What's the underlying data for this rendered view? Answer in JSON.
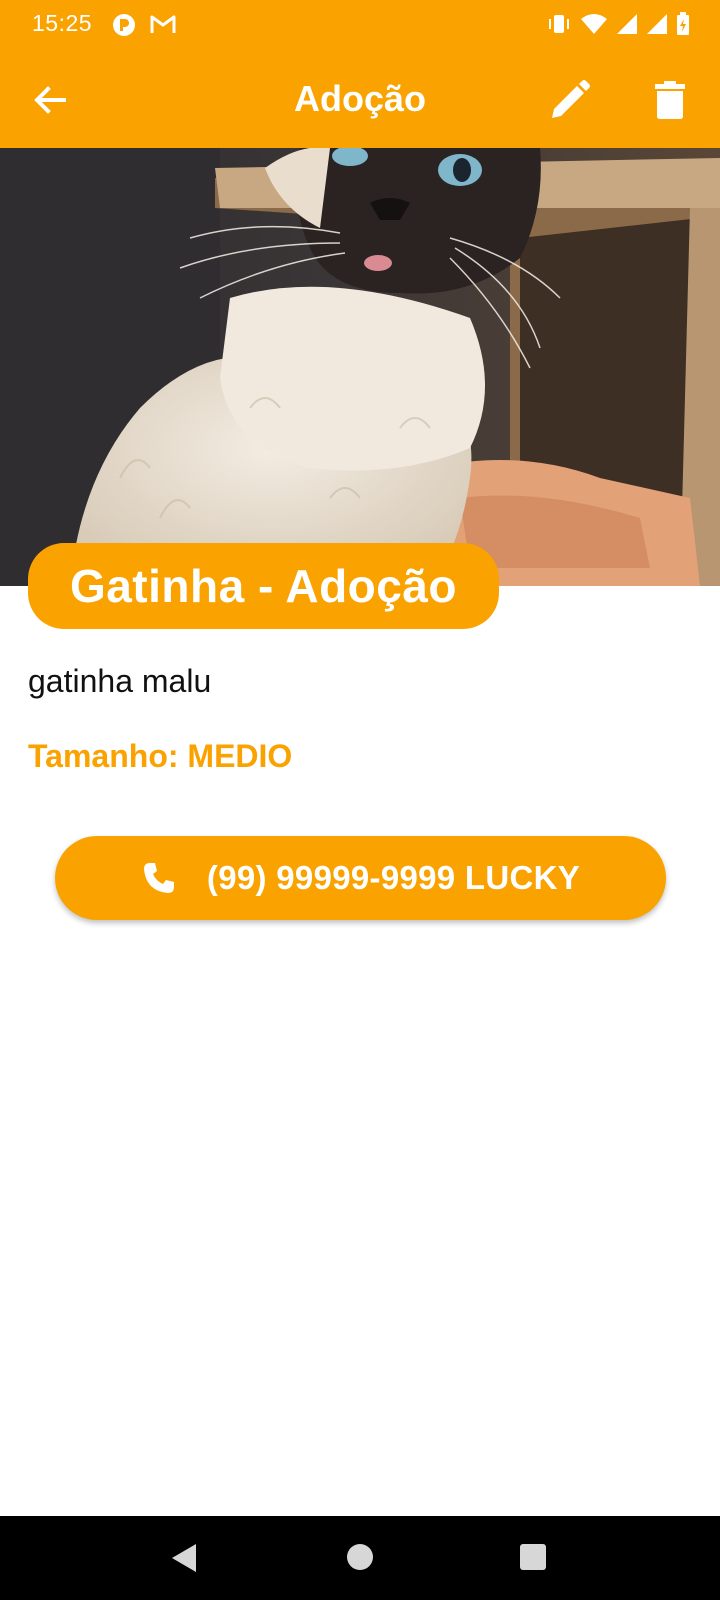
{
  "status_bar": {
    "time": "15:25",
    "icons_left": [
      "app-notification-icon",
      "gmail-icon"
    ],
    "icons_right": [
      "vibrate-icon",
      "wifi-icon",
      "signal-icon",
      "signal-icon",
      "battery-icon"
    ]
  },
  "app_bar": {
    "title": "Adoção",
    "back_icon": "arrow-back-icon",
    "edit_icon": "pencil-icon",
    "delete_icon": "trash-icon"
  },
  "pet": {
    "card_title": "Gatinha - Adoção",
    "description": "gatinha malu",
    "size_text": "Tamanho: MEDIO",
    "phone_label": "(99) 99999-9999 LUCKY",
    "phone_icon": "phone-icon"
  },
  "colors": {
    "accent": "#F9A200",
    "text_dark": "#111111",
    "nav_bar": "#000000"
  }
}
